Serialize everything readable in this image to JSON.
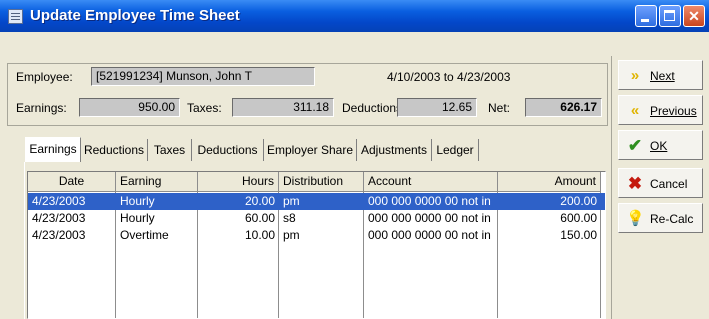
{
  "window": {
    "title": "Update Employee Time Sheet"
  },
  "info": {
    "employee_label": "Employee:",
    "employee_value": "[521991234] Munson, John T",
    "date_range": "4/10/2003 to 4/23/2003",
    "earnings_label": "Earnings:",
    "earnings_value": "950.00",
    "taxes_label": "Taxes:",
    "taxes_value": "311.18",
    "deductions_label": "Deductions:",
    "deductions_value": "12.65",
    "net_label": "Net:",
    "net_value": "626.17"
  },
  "tabs": [
    {
      "label": "Earnings",
      "active": true
    },
    {
      "label": "Reductions"
    },
    {
      "label": "Taxes"
    },
    {
      "label": "Deductions"
    },
    {
      "label": "Employer Share"
    },
    {
      "label": "Adjustments"
    },
    {
      "label": "Ledger"
    }
  ],
  "grid": {
    "columns": [
      "Date",
      "Earning",
      "Hours",
      "Distribution",
      "Account",
      "Amount"
    ],
    "rows": [
      {
        "date": "4/23/2003",
        "earning": "Hourly",
        "hours": "20.00",
        "distribution": "pm",
        "account": "000 000 0000 00  not in",
        "amount": "200.00",
        "selected": true
      },
      {
        "date": "4/23/2003",
        "earning": "Hourly",
        "hours": "60.00",
        "distribution": "s8",
        "account": "000 000 0000 00  not in",
        "amount": "600.00"
      },
      {
        "date": "4/23/2003",
        "earning": "Overtime",
        "hours": "10.00",
        "distribution": "pm",
        "account": "000 000 0000 00  not in",
        "amount": "150.00"
      }
    ]
  },
  "buttons": {
    "next": "Next",
    "previous": "Previous",
    "ok": "OK",
    "cancel": "Cancel",
    "recalc": "Re-Calc"
  },
  "colors": {
    "selection": "#2e61c8",
    "titlebar": "#0a5fe0",
    "window_bg": "#ece9d8"
  },
  "icons": {
    "next": "double-chevron-right-icon",
    "previous": "double-chevron-left-icon",
    "ok": "checkmark-icon",
    "cancel": "x-icon",
    "recalc": "lightbulb-icon"
  }
}
